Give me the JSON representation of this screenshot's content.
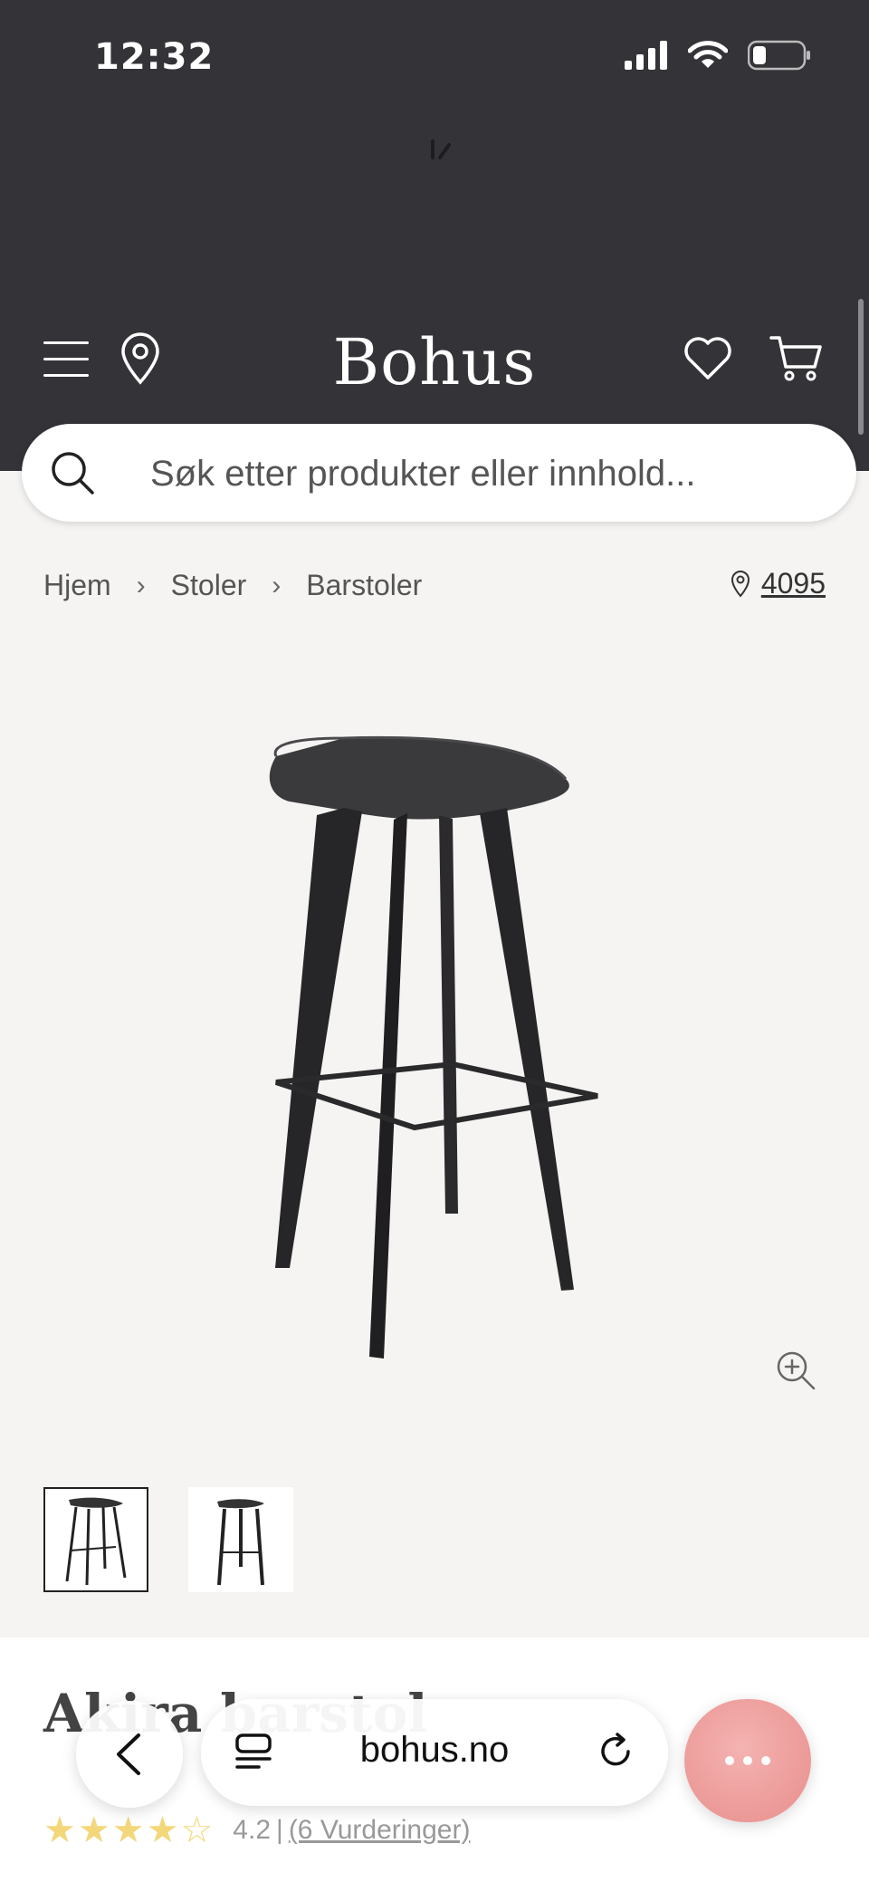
{
  "status": {
    "time": "12:32"
  },
  "header": {
    "logo": "Bohus"
  },
  "search": {
    "placeholder": "Søk etter produkter eller innhold..."
  },
  "breadcrumb": {
    "items": [
      "Hjem",
      "Stoler",
      "Barstoler"
    ],
    "store_code": "4095"
  },
  "product": {
    "title": "Akira barstol",
    "rating": "4.2",
    "stars_filled": 4,
    "stars_total": 5,
    "reviews": "(6 Vurderinger)"
  },
  "browser": {
    "url": "bohus.no"
  },
  "icons": [
    "menu-icon",
    "location-pin-icon",
    "heart-icon",
    "cart-icon",
    "search-icon",
    "zoom-in-icon",
    "back-icon",
    "tabs-icon",
    "reload-icon",
    "more-icon"
  ]
}
